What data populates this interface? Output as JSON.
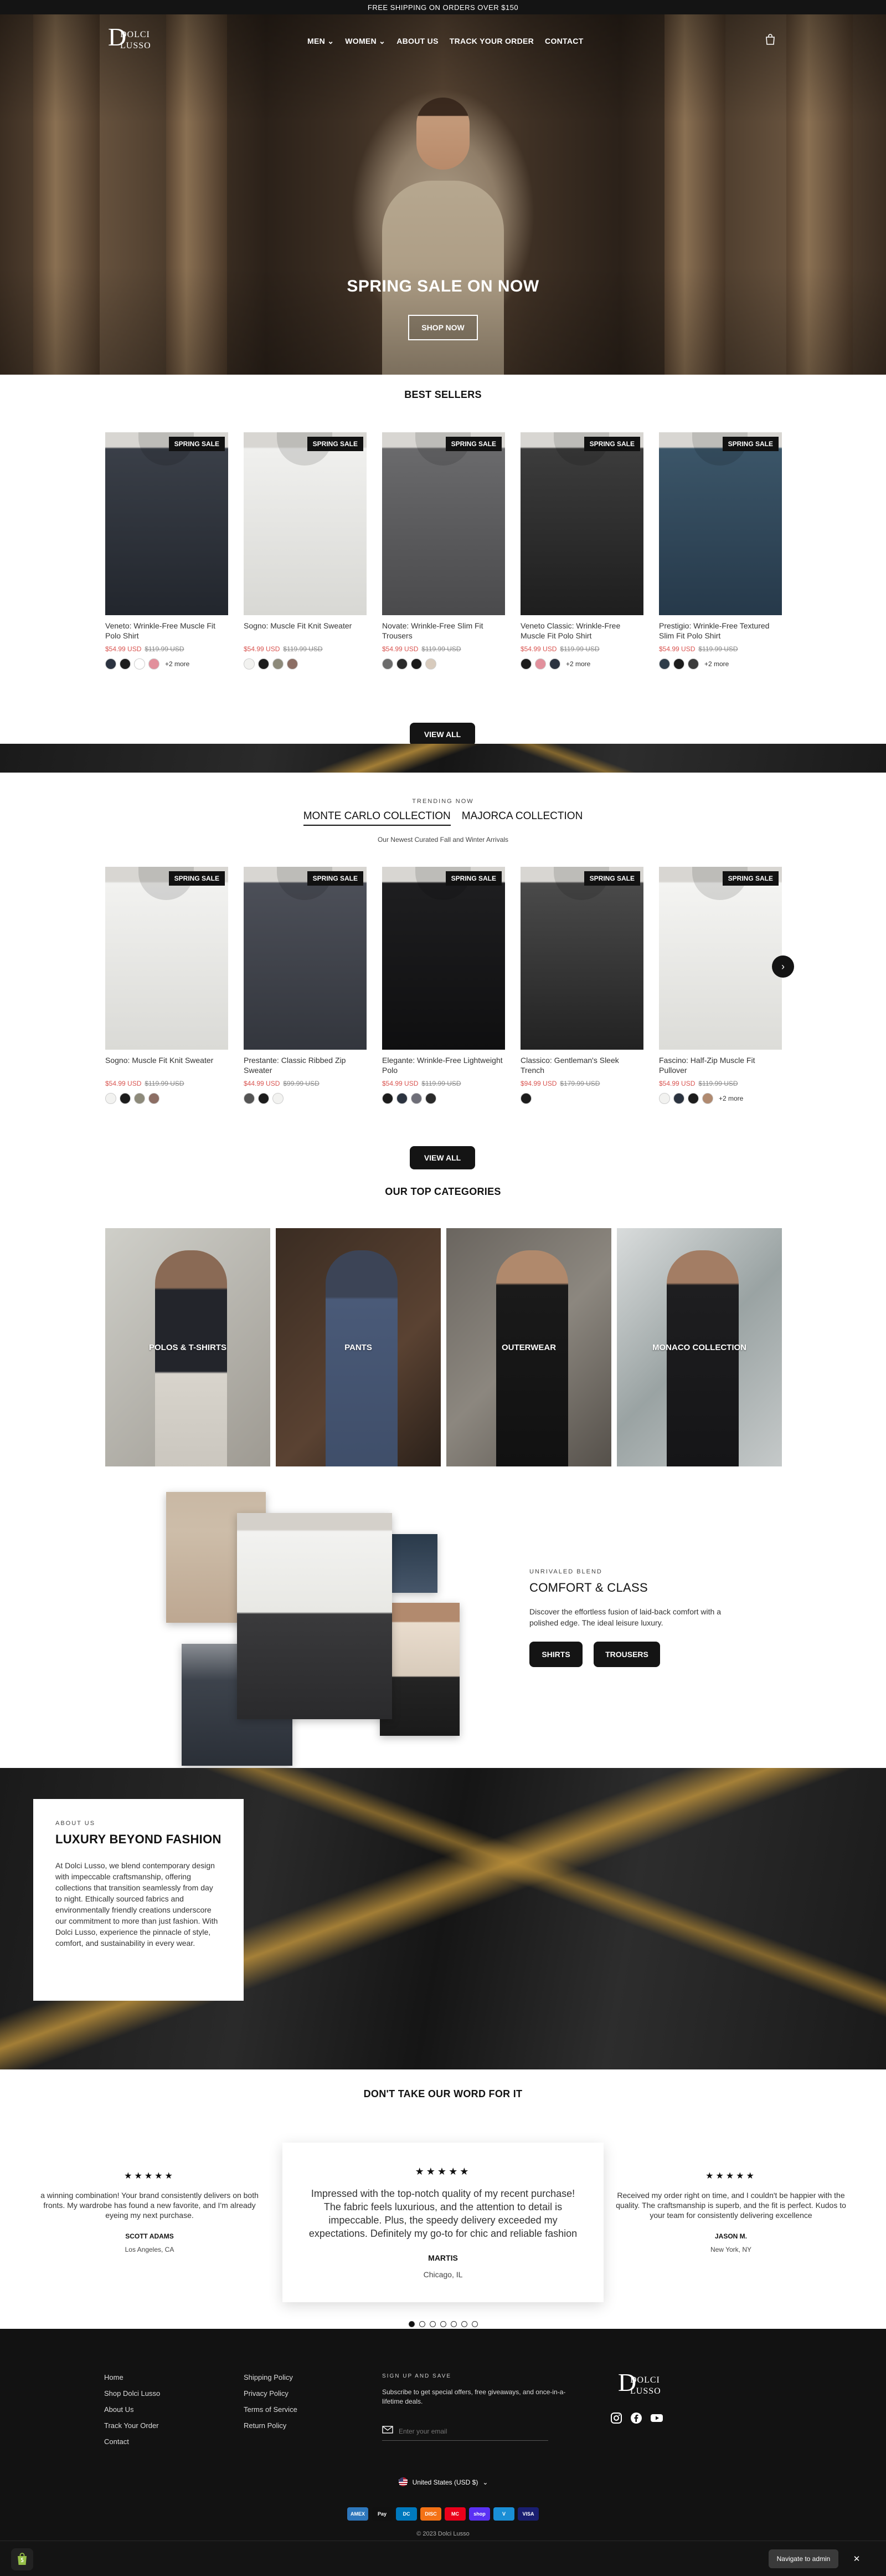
{
  "announcement": "FREE SHIPPING ON ORDERS OVER $150",
  "brand": {
    "line1": "DOLCI",
    "line2": "LUSSO",
    "initial": "D"
  },
  "nav": [
    {
      "label": "MEN",
      "has_dropdown": true
    },
    {
      "label": "WOMEN",
      "has_dropdown": true
    },
    {
      "label": "ABOUT US",
      "has_dropdown": false
    },
    {
      "label": "TRACK YOUR ORDER",
      "has_dropdown": false
    },
    {
      "label": "CONTACT",
      "has_dropdown": false
    }
  ],
  "cart_icon": "shopping-bag-icon",
  "hero": {
    "title": "SPRING SALE ON NOW",
    "button": "SHOP NOW"
  },
  "best_sellers": {
    "title": "BEST SELLERS",
    "products": [
      {
        "badge": "SPRING SALE",
        "name": "Veneto: Wrinkle-Free Muscle Fit Polo Shirt",
        "sale": "$54.99 USD",
        "old": "$119.99 USD",
        "swatches": [
          "#2b3340",
          "#1c1c1c",
          "#ffffff",
          "#e2909c"
        ],
        "more": "+2 more",
        "colors": [
          "#3a3f48",
          "#22262d"
        ]
      },
      {
        "badge": "SPRING SALE",
        "name": "Sogno: Muscle Fit Knit Sweater",
        "sale": "$54.99 USD",
        "old": "$119.99 USD",
        "swatches": [
          "#f2f2f0",
          "#1c1c1c",
          "#8d8a7a",
          "#8c6e64"
        ],
        "more": "",
        "colors": [
          "#f0f0ee",
          "#d8d8d4"
        ]
      },
      {
        "badge": "SPRING SALE",
        "name": "Novate: Wrinkle-Free Slim Fit Trousers",
        "sale": "$54.99 USD",
        "old": "$119.99 USD",
        "swatches": [
          "#6c6c6c",
          "#2a2a2a",
          "#1a1a1a",
          "#d8cbbd"
        ],
        "more": "",
        "colors": [
          "#6a6a6c",
          "#4a4a4c"
        ]
      },
      {
        "badge": "SPRING SALE",
        "name": "Veneto Classic: Wrinkle-Free Muscle Fit Polo Shirt",
        "sale": "$54.99 USD",
        "old": "$119.99 USD",
        "swatches": [
          "#1c1c1c",
          "#e2909c",
          "#2b3340"
        ],
        "more": "+2 more",
        "colors": [
          "#3c3c3c",
          "#1e1e1e"
        ]
      },
      {
        "badge": "SPRING SALE",
        "name": "Prestigio: Wrinkle-Free Textured Slim Fit Polo Shirt",
        "sale": "$54.99 USD",
        "old": "$119.99 USD",
        "swatches": [
          "#2f3d4a",
          "#1c1c1c",
          "#3a3a3a"
        ],
        "more": "+2 more",
        "colors": [
          "#3b5568",
          "#26394a"
        ]
      }
    ],
    "view_all": "VIEW ALL"
  },
  "trending": {
    "eyebrow": "TRENDING NOW",
    "tabs": [
      "MONTE CARLO COLLECTION",
      "MAJORCA COLLECTION"
    ],
    "subtitle": "Our Newest Curated Fall and Winter Arrivals",
    "products": [
      {
        "badge": "SPRING SALE",
        "name": "Sogno: Muscle Fit Knit Sweater",
        "sale": "$54.99 USD",
        "old": "$119.99 USD",
        "swatches": [
          "#f2f2f0",
          "#1c1c1c",
          "#8d8a7a",
          "#8c6e64"
        ],
        "more": "",
        "colors": [
          "#f2f2f0",
          "#dadad6"
        ]
      },
      {
        "badge": "SPRING SALE",
        "name": "Prestante: Classic Ribbed Zip Sweater",
        "sale": "$44.99 USD",
        "old": "$99.99 USD",
        "swatches": [
          "#555555",
          "#1c1c1c",
          "#f2f2f0"
        ],
        "more": "",
        "colors": [
          "#4c4f58",
          "#33363d"
        ]
      },
      {
        "badge": "SPRING SALE",
        "name": "Elegante: Wrinkle-Free Lightweight Polo",
        "sale": "$54.99 USD",
        "old": "$119.99 USD",
        "swatches": [
          "#1c1c1c",
          "#2b3340",
          "#6e6e78",
          "#2a2a2a"
        ],
        "more": "",
        "colors": [
          "#1e1e20",
          "#0f0f10"
        ]
      },
      {
        "badge": "SPRING SALE",
        "name": "Classico: Gentleman's Sleek Trench",
        "sale": "$94.99 USD",
        "old": "$179.99 USD",
        "swatches": [
          "#1c1c1c"
        ],
        "more": "",
        "colors": [
          "#4a4a4a",
          "#222222"
        ]
      },
      {
        "badge": "SPRING SALE",
        "name": "Fascino: Half-Zip Muscle Fit Pullover",
        "sale": "$54.99 USD",
        "old": "$119.99 USD",
        "swatches": [
          "#f2f2f0",
          "#2b3340",
          "#1c1c1c",
          "#b08a70"
        ],
        "more": "+2 more",
        "colors": [
          "#f4f4f2",
          "#dcdcd8"
        ]
      }
    ],
    "view_all": "VIEW ALL"
  },
  "categories": {
    "title": "OUR TOP CATEGORIES",
    "items": [
      {
        "label": "POLOS & T-SHIRTS"
      },
      {
        "label": "PANTS"
      },
      {
        "label": "OUTERWEAR"
      },
      {
        "label": "MONACO COLLECTION"
      }
    ]
  },
  "comfort": {
    "eyebrow": "UNRIVALED BLEND",
    "title": "COMFORT & CLASS",
    "text": "Discover the effortless fusion of laid-back comfort with a polished edge. The ideal leisure luxury.",
    "buttons": [
      "SHIRTS",
      "TROUSERS"
    ]
  },
  "about": {
    "eyebrow": "ABOUT US",
    "title": "LUXURY BEYOND FASHION",
    "body": "At Dolci Lusso, we blend contemporary design with impeccable craftsmanship, offering collections that transition seamlessly from day to night. Ethically sourced fabrics and environmentally friendly creations underscore our commitment to more than just fashion. With Dolci Lusso, experience the pinnacle of style, comfort, and sustainability in every wear."
  },
  "testimonials": {
    "title": "DON'T TAKE OUR WORD FOR IT",
    "stars": "★★★★★",
    "items": [
      {
        "text": "a winning combination! Your brand consistently delivers on both fronts. My wardrobe has found a new favorite, and I'm already eyeing my next purchase.",
        "name": "SCOTT ADAMS",
        "location": "Los Angeles, CA"
      },
      {
        "text": "Impressed with the top-notch quality of my recent purchase! The fabric feels luxurious, and the attention to detail is impeccable. Plus, the speedy delivery exceeded my expectations. Definitely my go-to for chic and reliable fashion",
        "name": "MARTIS",
        "location": "Chicago, IL"
      },
      {
        "text": "Received my order right on time, and I couldn't be happier with the quality. The craftsmanship is superb, and the fit is perfect. Kudos to your team for consistently delivering excellence",
        "name": "JASON M.",
        "location": "New York, NY"
      }
    ],
    "dot_count": 7
  },
  "footer": {
    "col1": [
      "Home",
      "Shop Dolci Lusso",
      "About Us",
      "Track Your Order",
      "Contact"
    ],
    "col2": [
      "Shipping Policy",
      "Privacy Policy",
      "Terms of Service",
      "Return Policy"
    ],
    "signup_title": "SIGN UP AND SAVE",
    "signup_text": "Subscribe to get special offers, free giveaways, and once-in-a-lifetime deals.",
    "email_placeholder": "Enter your email",
    "social": [
      "instagram-icon",
      "facebook-icon",
      "youtube-icon"
    ],
    "currency": "United States (USD $)",
    "payments": [
      {
        "label": "AMEX",
        "color": "#2e77bc"
      },
      {
        "label": "Pay",
        "color": "#111111"
      },
      {
        "label": "DC",
        "color": "#0079be"
      },
      {
        "label": "DISC",
        "color": "#f47216"
      },
      {
        "label": "MC",
        "color": "#eb001b"
      },
      {
        "label": "shop",
        "color": "#5a31f4"
      },
      {
        "label": "V",
        "color": "#1a8fd6"
      },
      {
        "label": "VISA",
        "color": "#1a1f71"
      }
    ],
    "copyright": "© 2023 Dolci Lusso"
  },
  "admin_bar": {
    "button": "Navigate to admin",
    "close": "✕"
  }
}
